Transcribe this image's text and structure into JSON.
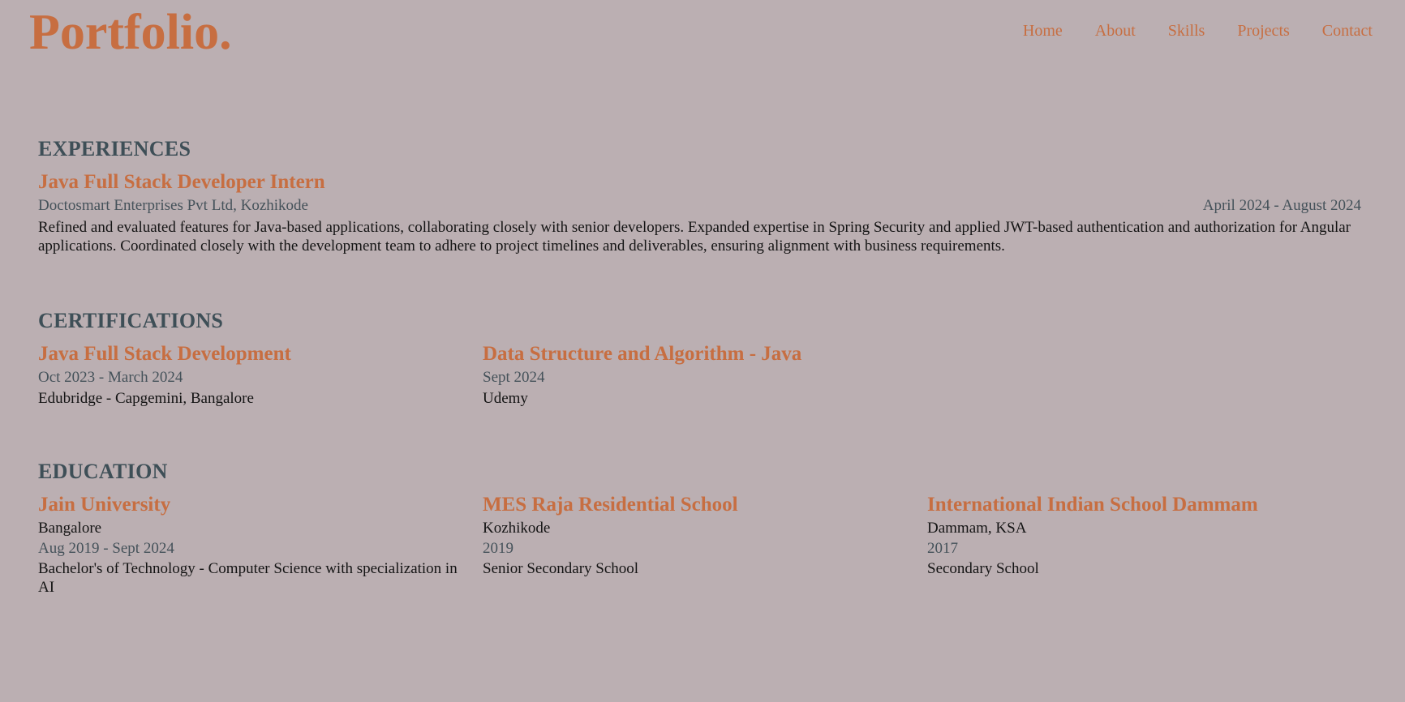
{
  "header": {
    "logo": "Portfolio.",
    "nav": [
      "Home",
      "About",
      "Skills",
      "Projects",
      "Contact"
    ]
  },
  "experiences": {
    "title": "EXPERIENCES",
    "items": [
      {
        "role": "Java Full Stack Developer Intern",
        "company": "Doctosmart Enterprises Pvt Ltd, Kozhikode",
        "dates": "April 2024 - August 2024",
        "description": "Refined and evaluated features for Java-based applications, collaborating closely with senior developers. Expanded expertise in Spring Security and applied JWT-based authentication and authorization for Angular applications. Coordinated closely with the development team to adhere to project timelines and deliverables, ensuring alignment with business requirements."
      }
    ]
  },
  "certifications": {
    "title": "CERTIFICATIONS",
    "items": [
      {
        "name": "Java Full Stack Development",
        "dates": "Oct 2023 - March 2024",
        "issuer": "Edubridge - Capgemini, Bangalore"
      },
      {
        "name": "Data Structure and Algorithm - Java",
        "dates": "Sept 2024",
        "issuer": "Udemy"
      }
    ]
  },
  "education": {
    "title": "EDUCATION",
    "items": [
      {
        "school": "Jain University",
        "location": "Bangalore",
        "dates": "Aug 2019 - Sept 2024",
        "degree": "Bachelor's of Technology - Computer Science with specialization in AI"
      },
      {
        "school": "MES Raja Residential School",
        "location": "Kozhikode",
        "dates": "2019",
        "degree": "Senior Secondary School"
      },
      {
        "school": "International Indian School Dammam",
        "location": "Dammam, KSA",
        "dates": "2017",
        "degree": "Secondary School"
      }
    ]
  },
  "colors": {
    "background": "#bbafb2",
    "accent": "#c76e41",
    "heading": "#3e4f57",
    "muted_text": "#45525a",
    "body_text": "#141414"
  }
}
